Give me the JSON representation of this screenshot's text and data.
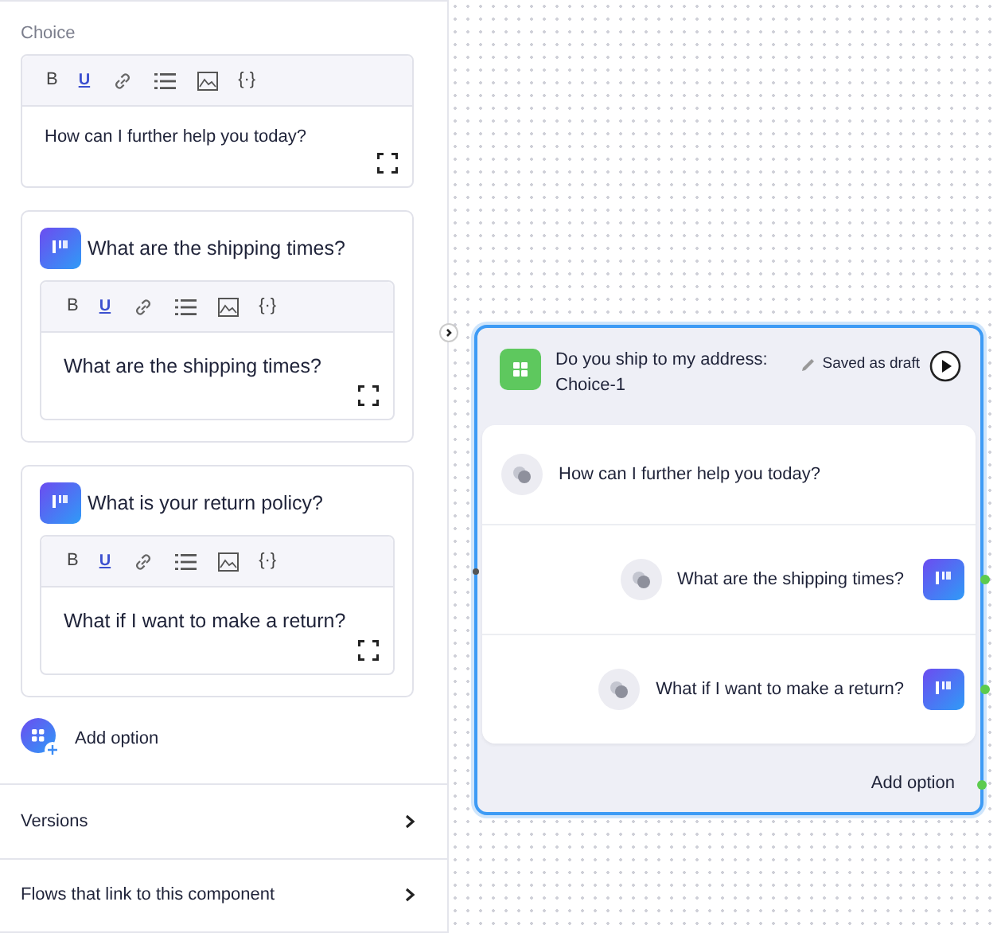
{
  "sidebar": {
    "section_label": "Choice",
    "prompt_editor": {
      "toolbar": [
        {
          "kind": "bold",
          "label": "B"
        },
        {
          "kind": "underline",
          "label": "U"
        },
        {
          "kind": "link"
        },
        {
          "kind": "list"
        },
        {
          "kind": "image"
        },
        {
          "kind": "variable",
          "label": "{·}"
        }
      ],
      "value": "How can I further help you today?"
    },
    "options": [
      {
        "title": "What are the shipping times?",
        "editor": {
          "toolbar": [
            {
              "kind": "bold",
              "label": "B"
            },
            {
              "kind": "underline",
              "label": "U"
            },
            {
              "kind": "link"
            },
            {
              "kind": "list"
            },
            {
              "kind": "image"
            },
            {
              "kind": "variable",
              "label": "{·}"
            }
          ],
          "value": "What are the shipping times?"
        }
      },
      {
        "title": "What is your return policy?",
        "editor": {
          "toolbar": [
            {
              "kind": "bold",
              "label": "B"
            },
            {
              "kind": "underline",
              "label": "U"
            },
            {
              "kind": "link"
            },
            {
              "kind": "list"
            },
            {
              "kind": "image"
            },
            {
              "kind": "variable",
              "label": "{·}"
            }
          ],
          "value": "What if I want to make a return?"
        }
      }
    ],
    "add_option": "Add option",
    "links": [
      {
        "label": "Versions"
      },
      {
        "label": "Flows that link to this component"
      }
    ]
  },
  "canvas": {
    "node": {
      "title": "Do you ship to my address: Choice-1",
      "status": "Saved as draft",
      "selected": true,
      "prompt": "How can I further help you today?",
      "options": [
        {
          "label": "What are the shipping times?",
          "connected": true
        },
        {
          "label": "What if I want to make a return?",
          "connected": true
        }
      ],
      "add_option": "Add option",
      "add_option_connected": true
    }
  }
}
